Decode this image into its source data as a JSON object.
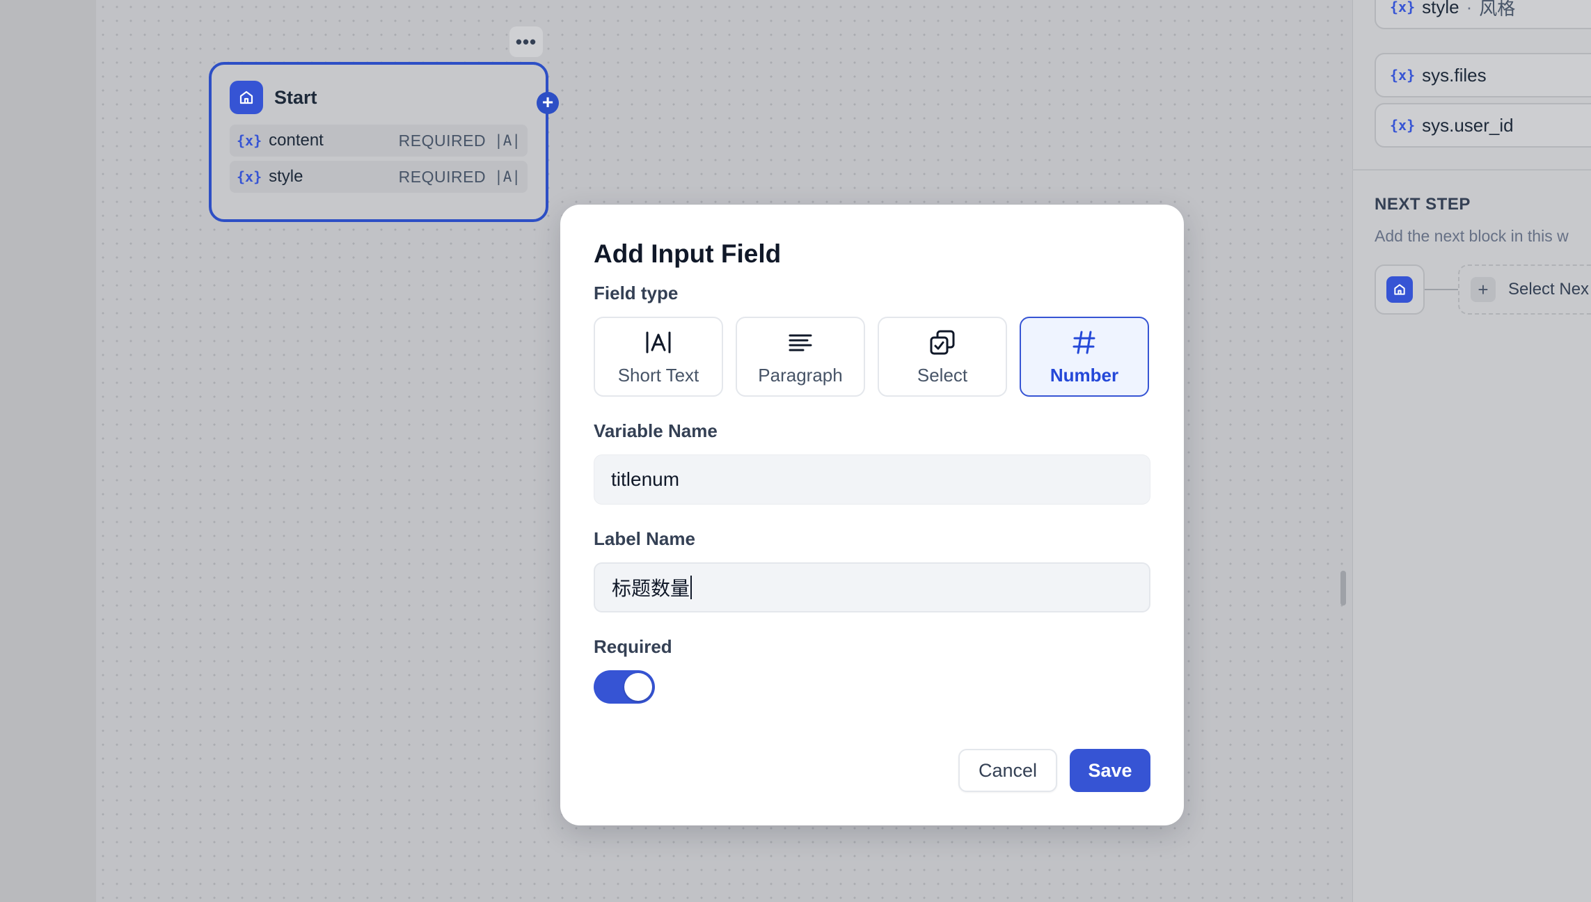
{
  "workflow_node": {
    "title": "Start",
    "more_label": "•••",
    "add_label": "+",
    "var_icon": "{x}",
    "variables": [
      {
        "name": "content",
        "required": "REQUIRED",
        "type_icon": "|A|"
      },
      {
        "name": "style",
        "required": "REQUIRED",
        "type_icon": "|A|"
      }
    ]
  },
  "side_panel": {
    "var_icon": "{x}",
    "variables": [
      {
        "name": "style",
        "separator": "·",
        "label": "风格"
      },
      {
        "name": "sys.files"
      },
      {
        "name": "sys.user_id"
      }
    ],
    "next_step": {
      "title": "NEXT STEP",
      "description": "Add the next block in this w",
      "select_label": "Select Nex",
      "plus_label": "+"
    }
  },
  "modal": {
    "title": "Add Input Field",
    "field_type_label": "Field type",
    "field_types": [
      {
        "label": "Short Text",
        "icon": "short-text-icon"
      },
      {
        "label": "Paragraph",
        "icon": "paragraph-icon"
      },
      {
        "label": "Select",
        "icon": "select-icon"
      },
      {
        "label": "Number",
        "icon": "number-icon",
        "selected": true
      }
    ],
    "variable_name_label": "Variable Name",
    "variable_name_value": "titlenum",
    "label_name_label": "Label Name",
    "label_name_value": "标题数量",
    "required_label": "Required",
    "required_on": true,
    "cancel_label": "Cancel",
    "save_label": "Save"
  },
  "colors": {
    "accent": "#3654d4",
    "selected_bg": "#eff4ff",
    "overlay": "#c4c6cb"
  }
}
